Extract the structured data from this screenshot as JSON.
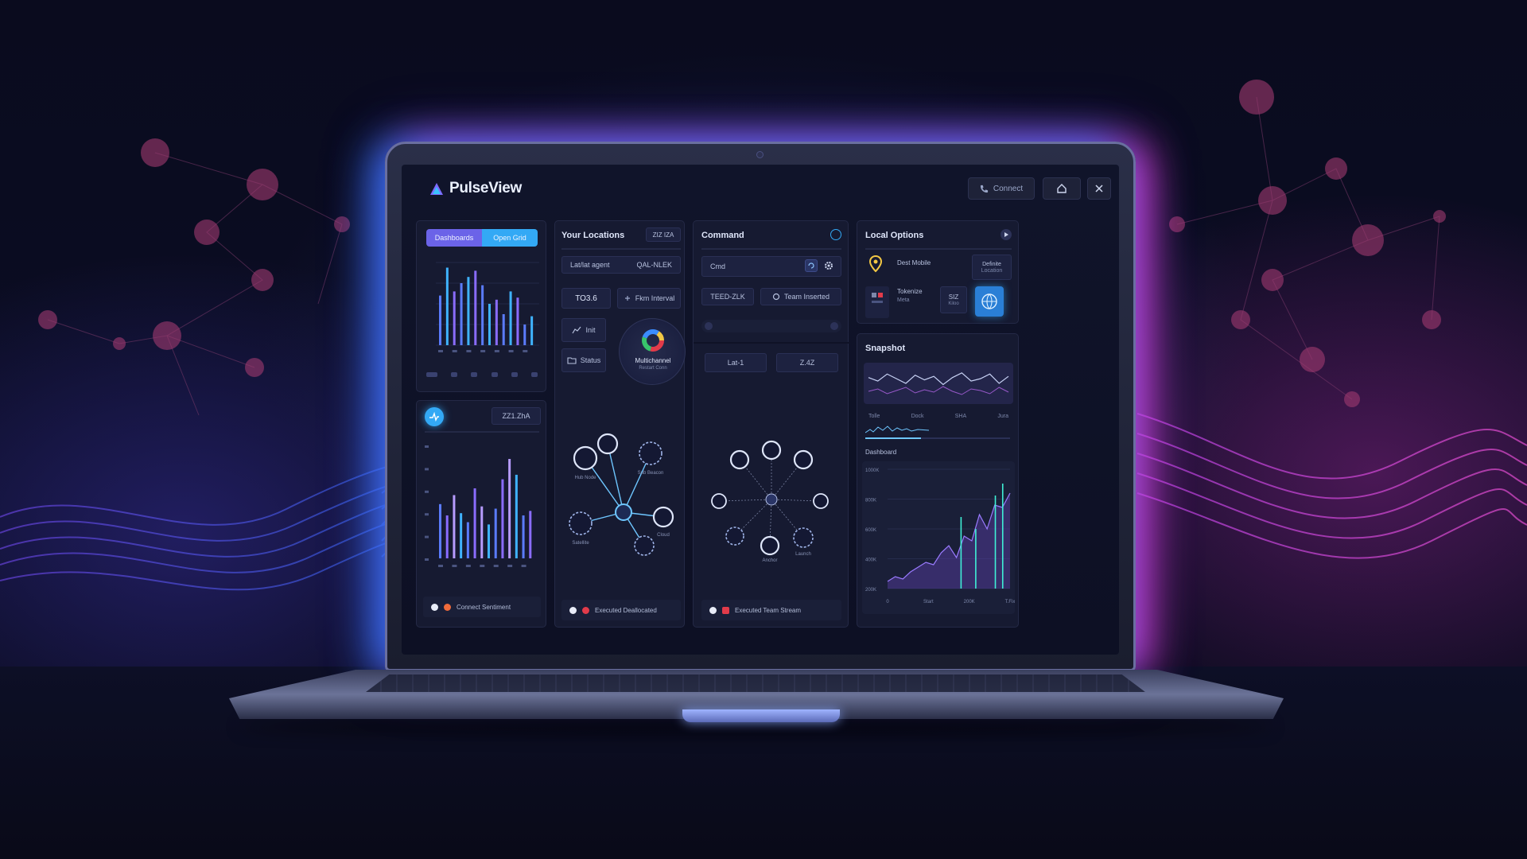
{
  "app": {
    "title": "PulseView"
  },
  "header": {
    "contact_label": "Connect",
    "home_label": "home",
    "close_label": "close"
  },
  "panel_left_top": {
    "tabs": [
      {
        "label": "Dashboards",
        "active": false
      },
      {
        "label": "Open Grid",
        "active": true
      }
    ],
    "chart_data": {
      "type": "bar",
      "values": [
        48,
        75,
        52,
        60,
        66,
        72,
        58,
        40,
        44,
        30,
        52,
        46,
        20,
        28
      ],
      "colors": [
        "#5b7cff",
        "#3fb3ff",
        "#8a6cff",
        "#5b7cff",
        "#3fb3ff",
        "#8a6cff",
        "#5b7cff",
        "#3fb3ff",
        "#8a6cff",
        "#5b7cff",
        "#3fb3ff",
        "#8a6cff",
        "#5b7cff",
        "#3fb3ff"
      ],
      "ylim": [
        0,
        80
      ]
    }
  },
  "panel_left_bottom": {
    "badge_value": "ZZ1.ZhA",
    "chart_data": {
      "type": "bar",
      "values": [
        48,
        38,
        56,
        40,
        32,
        62,
        46,
        30,
        44,
        70,
        88,
        74,
        38,
        42
      ],
      "ylim": [
        0,
        100
      ]
    },
    "footer_label": "Connect Sentiment"
  },
  "panel_locations": {
    "title": "Your Locations",
    "badge": "ZIZ IZA",
    "row1_left": "Lat/lat agent",
    "row1_right": "QAL-NLEK",
    "row2_left": "TO3.6",
    "row2_right": "Fkm Interval",
    "item1": "Init",
    "item2": "Status",
    "center_label": "Multichannel",
    "center_sub": "Restart Conn",
    "network_labels": [
      "Hub Node",
      "Sub Beacon",
      "Satellite",
      "Cloud"
    ],
    "footer_label": "Executed Deallocated"
  },
  "panel_command": {
    "title": "Command",
    "input_value": "Cmd",
    "chip1": "TEED-ZLK",
    "chip2": "Team Inserted",
    "chip3": "Lat-1",
    "chip4": "Z.4Z",
    "network_labels": [
      "Anchor",
      "Launch"
    ],
    "footer_label": "Executed Team Stream"
  },
  "panel_local_options": {
    "title": "Local Options",
    "item1_label": "Dest Mobile",
    "item1_right": "Definite",
    "item1_right_sub": "Location",
    "item2_label": "Tokenize",
    "item2_sub": "Meta",
    "item2_value": "SIZ",
    "item2_value_sub": "Kiloo"
  },
  "panel_snapshot": {
    "title": "Snapshot",
    "chart_data": {
      "type": "line",
      "values": [
        40,
        34,
        46,
        38,
        30,
        44,
        36,
        42,
        28,
        40,
        48,
        34,
        38,
        46,
        30,
        42
      ],
      "ylim": [
        0,
        60
      ]
    },
    "tick_labels": [
      "Tolle",
      "Dock",
      "SHA",
      "Jura"
    ],
    "subtitle": "Dashboard",
    "area_chart_data": {
      "type": "area",
      "values": [
        6,
        10,
        8,
        14,
        18,
        22,
        20,
        30,
        36,
        26,
        44,
        40,
        62,
        50,
        70,
        68,
        80
      ],
      "ylim": [
        0,
        100
      ],
      "y_tick_labels": [
        "1000K",
        "800K",
        "600K",
        "400K",
        "200K"
      ],
      "x_tick_labels": [
        "0",
        "Start",
        "200K",
        "T.Fix"
      ]
    }
  }
}
